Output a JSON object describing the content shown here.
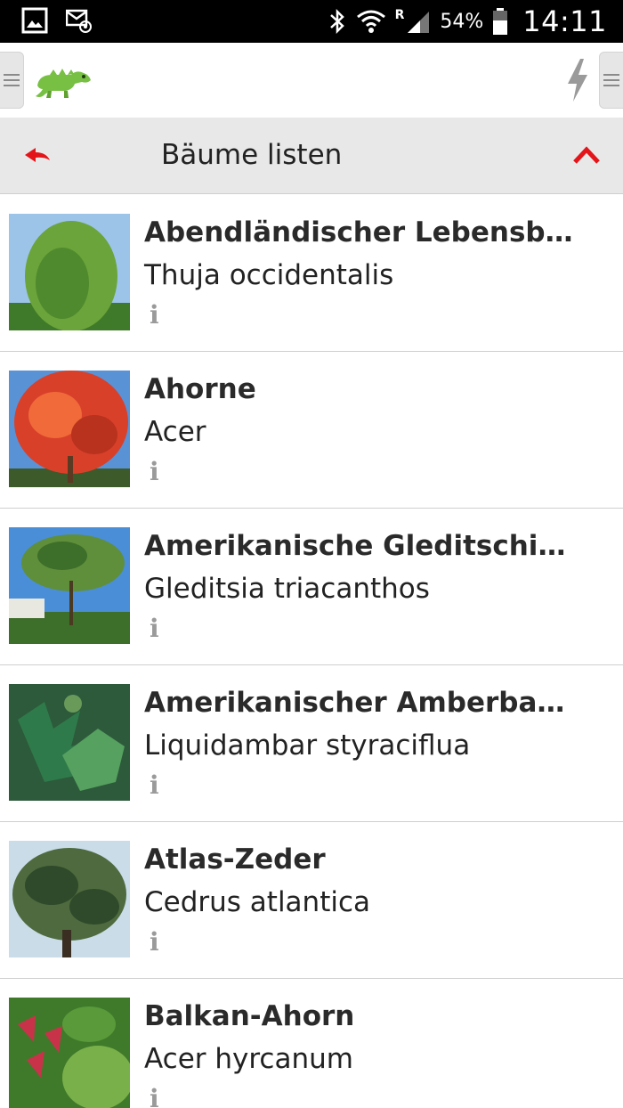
{
  "status_bar": {
    "left_icons": [
      "gallery-icon",
      "email-notification-icon"
    ],
    "right_icons": [
      "bluetooth-icon",
      "wifi-icon",
      "signal-icon",
      "battery-icon"
    ],
    "network_label": "R",
    "battery_percent": "54%",
    "time": "14:11"
  },
  "header": {
    "left_menu_icon": "menu-icon",
    "logo_icon": "iguana-logo-icon",
    "right_action_icon": "lightning-icon",
    "right_menu_icon": "menu-icon"
  },
  "title_bar": {
    "back_icon": "back-arrow-icon",
    "title": "Bäume listen",
    "up_icon": "chevron-up-icon",
    "accent_color": "#e3151a"
  },
  "list": {
    "info_glyph": "i",
    "items": [
      {
        "name": "Abendländischer Lebensbaum",
        "latin": "Thuja occidentalis",
        "thumb_palette": [
          "#9cc4e8",
          "#3f7a2a",
          "#6aa43a"
        ]
      },
      {
        "name": "Ahorne",
        "latin": "Acer",
        "thumb_palette": [
          "#5a92d6",
          "#d8402a",
          "#f06a3a"
        ]
      },
      {
        "name": "Amerikanische Gleditschie, L...",
        "latin": "Gleditsia triacanthos",
        "thumb_palette": [
          "#4a8ed8",
          "#3d6e2a",
          "#5f8f3a"
        ]
      },
      {
        "name": "Amerikanischer Amberbaum",
        "latin": "Liquidambar styraciflua",
        "thumb_palette": [
          "#2c5a3a",
          "#2f7a4a",
          "#56a060"
        ]
      },
      {
        "name": "Atlas-Zeder",
        "latin": "Cedrus atlantica",
        "thumb_palette": [
          "#c9dce8",
          "#2f4a2a",
          "#4e6a3e"
        ]
      },
      {
        "name": "Balkan-Ahorn",
        "latin": "Acer hyrcanum",
        "thumb_palette": [
          "#3f7a2a",
          "#c8334a",
          "#7ab04a"
        ]
      }
    ]
  }
}
